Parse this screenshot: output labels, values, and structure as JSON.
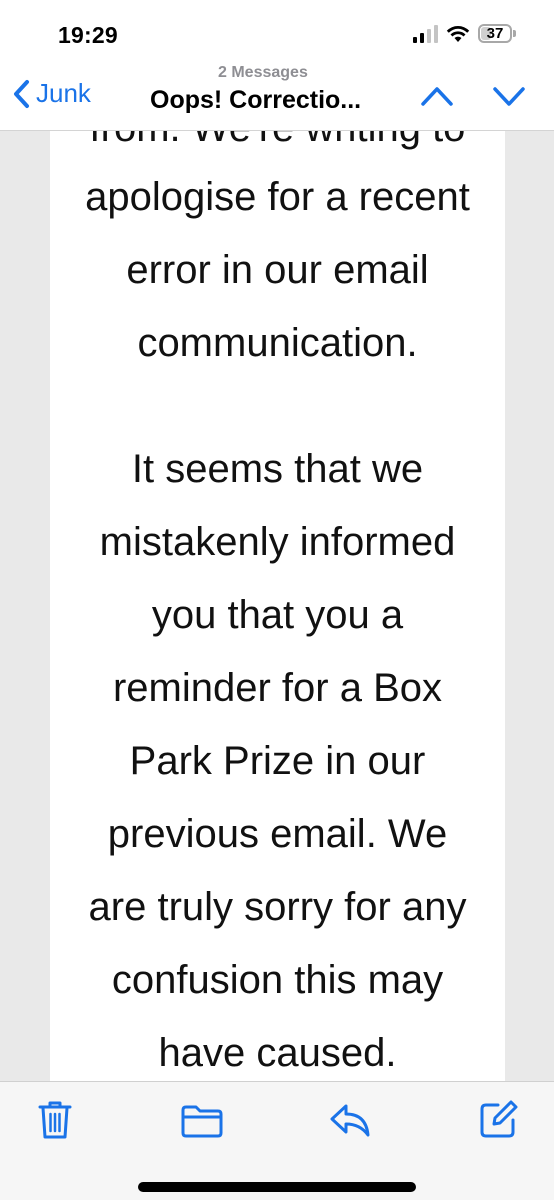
{
  "status_bar": {
    "time": "19:29",
    "battery_text": "37",
    "battery_level": 0.37,
    "signal_bars_filled": 2,
    "signal_bars_total": 4
  },
  "nav": {
    "back_label": "Junk",
    "message_count": "2 Messages",
    "subject": "Oops! Correctio...",
    "accent_color": "#1a73e8"
  },
  "email": {
    "clipped_top_text": "from. We're writing to",
    "paragraphs": [
      {
        "lines": [
          "apologise for a recent",
          "error in our email",
          "communication."
        ]
      },
      {
        "lines": [
          "It seems that we",
          "mistakenly informed",
          "you that you a",
          "reminder for a Box",
          "Park Prize in our",
          "previous email. We",
          "are truly sorry for any",
          "confusion this may",
          "have caused."
        ]
      }
    ]
  },
  "toolbar": {
    "icons": [
      "trash-icon",
      "folder-icon",
      "reply-icon",
      "compose-icon"
    ]
  }
}
